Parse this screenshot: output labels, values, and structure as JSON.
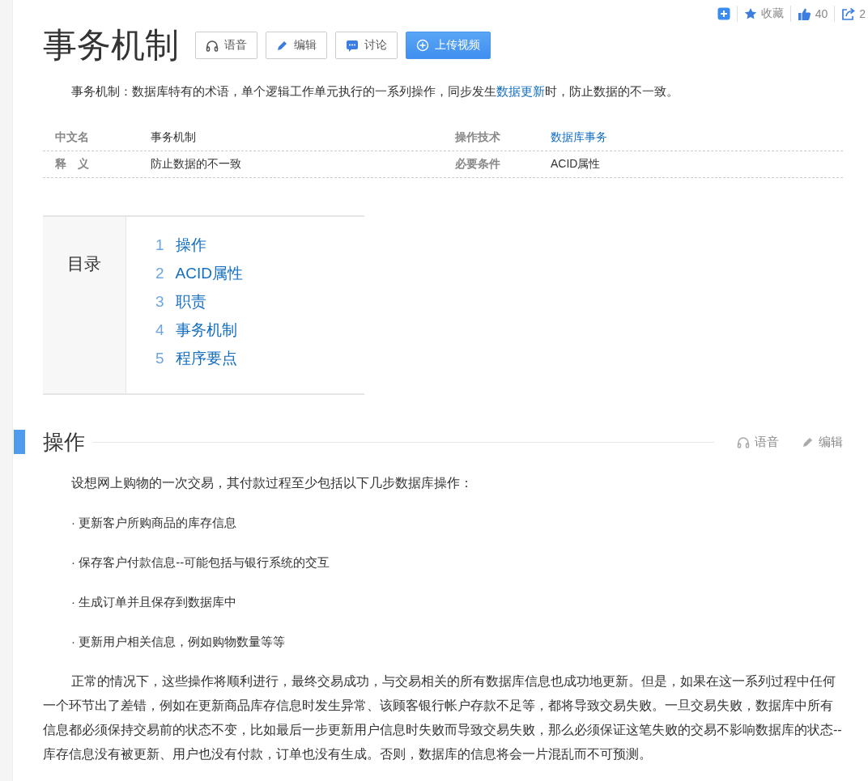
{
  "toolbar": {
    "favorite": "收藏",
    "likes": "40",
    "shares": "2"
  },
  "title": "事务机制",
  "title_buttons": [
    {
      "kind": "audio",
      "label": "语音"
    },
    {
      "kind": "edit",
      "label": "编辑"
    },
    {
      "kind": "discuss",
      "label": "讨论"
    },
    {
      "kind": "upload",
      "label": "上传视频"
    }
  ],
  "summary": [
    {
      "text": "事务机制：数据库特有的术语，单个逻辑工作单元执行的一系列操作，同步发生",
      "link": false
    },
    {
      "text": "数据更新",
      "link": true
    },
    {
      "text": "时，防止数据的不一致。",
      "link": false
    }
  ],
  "basic_info": [
    [
      {
        "label": "中文名",
        "value": "事务机制",
        "link": false
      },
      {
        "label": "操作技术",
        "value": "数据库事务",
        "link": true
      }
    ],
    [
      {
        "label": "释　义",
        "value": "防止数据的不一致",
        "link": false
      },
      {
        "label": "必要条件",
        "value": "ACID属性",
        "link": false
      }
    ]
  ],
  "toc": {
    "title": "目录",
    "items": [
      {
        "number": "1",
        "label": "操作"
      },
      {
        "number": "2",
        "label": "ACID属性"
      },
      {
        "number": "3",
        "label": "职责"
      },
      {
        "number": "4",
        "label": "事务机制"
      },
      {
        "number": "5",
        "label": "程序要点"
      }
    ]
  },
  "section": {
    "title": "操作",
    "actions": [
      {
        "kind": "audio",
        "label": "语音"
      },
      {
        "kind": "edit",
        "label": "编辑"
      }
    ],
    "paragraphs": [
      {
        "kind": "text",
        "text": "设想网上购物的一次交易，其付款过程至少包括以下几步数据库操作："
      },
      {
        "kind": "bullet",
        "text": "· 更新客户所购商品的库存信息"
      },
      {
        "kind": "bullet",
        "text": "· 保存客户付款信息--可能包括与银行系统的交互"
      },
      {
        "kind": "bullet",
        "text": "· 生成订单并且保存到数据库中"
      },
      {
        "kind": "bullet",
        "text": "· 更新用户相关信息，例如购物数量等等"
      },
      {
        "kind": "text",
        "text": "正常的情况下，这些操作将顺利进行，最终交易成功，与交易相关的所有数据库信息也成功地更新。但是，如果在这一系列过程中任何一个环节出了差错，例如在更新商品库存信息时发生异常、该顾客银行帐户存款不足等，都将导致交易失败。一旦交易失败，数据库中所有信息都必须保持交易前的状态不变，比如最后一步更新用户信息时失败而导致交易失败，那么必须保证这笔失败的交易不影响数据库的状态--库存信息没有被更新、用户也没有付款，订单也没有生成。否则，数据库的信息将会一片混乱而不可预测。"
      }
    ]
  }
}
